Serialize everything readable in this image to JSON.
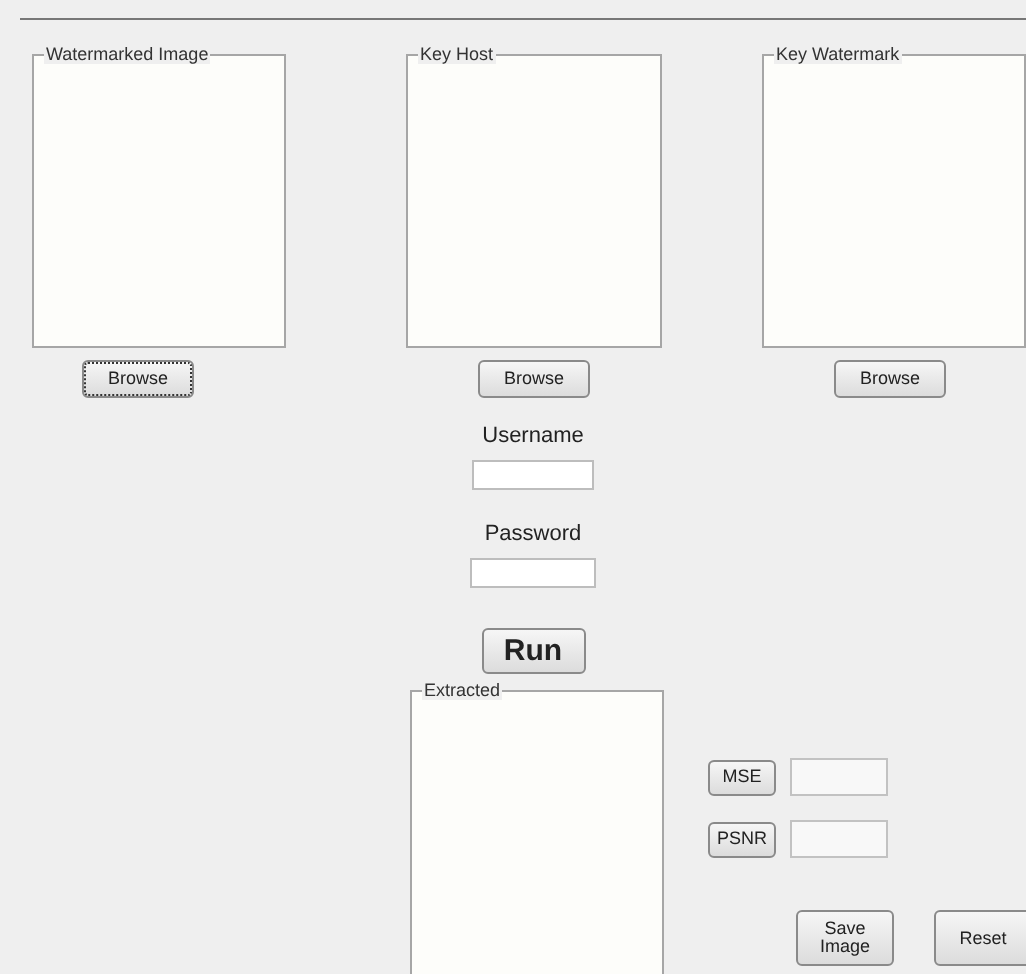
{
  "image_panels": [
    {
      "title": "Watermarked Image",
      "button": "Browse",
      "focused": true
    },
    {
      "title": "Key Host",
      "button": "Browse",
      "focused": false
    },
    {
      "title": "Key Watermark",
      "button": "Browse",
      "focused": false
    }
  ],
  "login": {
    "username_label": "Username",
    "password_label": "Password"
  },
  "run_button": "Run",
  "extracted_panel": {
    "title": "Extracted"
  },
  "metrics": [
    {
      "label": "MSE"
    },
    {
      "label": "PSNR"
    }
  ],
  "actions": [
    "Save Image",
    "Reset"
  ]
}
